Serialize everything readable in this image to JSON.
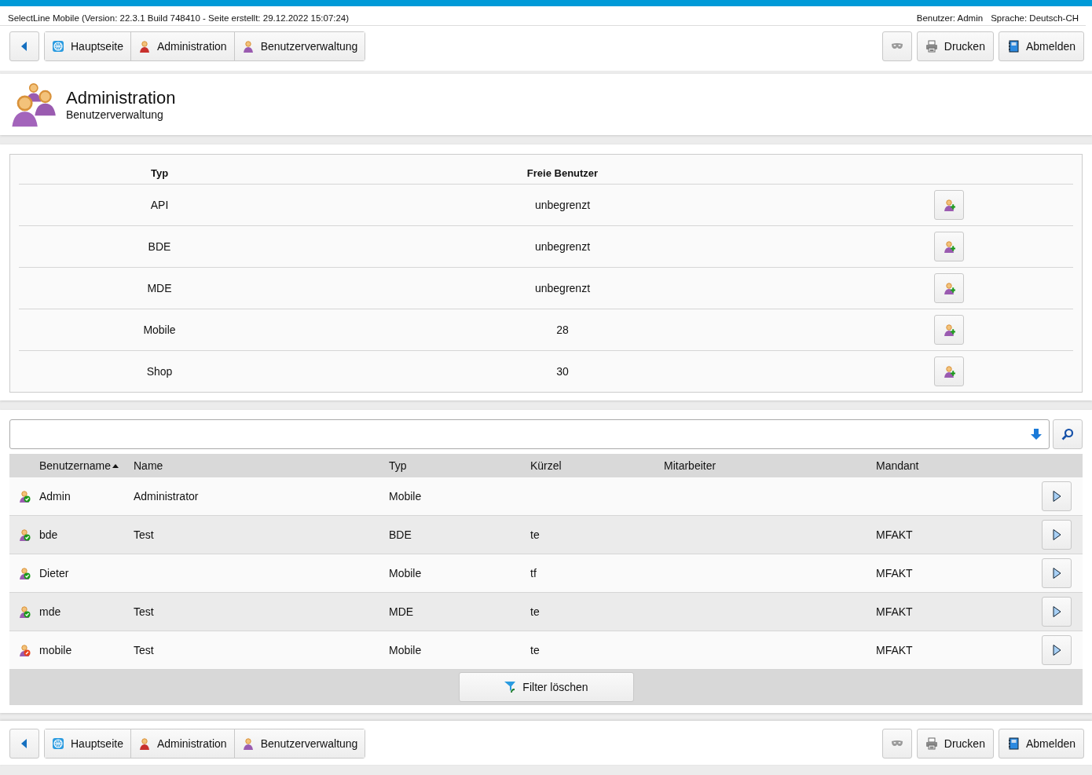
{
  "header": {
    "info": "SelectLine Mobile (Version: 22.3.1 Build 748410 - Seite erstellt: 29.12.2022 15:07:24)",
    "user": "Benutzer: Admin",
    "language": "Sprache: Deutsch-CH"
  },
  "nav_top": {
    "breadcrumbs": [
      {
        "kind": "globe",
        "label": "Hauptseite"
      },
      {
        "kind": "admin",
        "label": "Administration"
      },
      {
        "kind": "user",
        "label": "Benutzerverwaltung"
      }
    ],
    "actions": [
      {
        "kind": "mask"
      },
      {
        "kind": "print",
        "label": "Drucken"
      },
      {
        "kind": "logout",
        "label": "Abmelden"
      }
    ]
  },
  "page_header": {
    "title": "Administration",
    "subtitle": "Benutzerverwaltung"
  },
  "license_table": {
    "columns": [
      "Typ",
      "Freie Benutzer"
    ],
    "rows": [
      {
        "type": "API",
        "free": "unbegrenzt"
      },
      {
        "type": "BDE",
        "free": "unbegrenzt"
      },
      {
        "type": "MDE",
        "free": "unbegrenzt"
      },
      {
        "type": "Mobile",
        "free": "28"
      },
      {
        "type": "Shop",
        "free": "30"
      }
    ]
  },
  "users_table": {
    "columns": [
      {
        "label": "Benutzername",
        "sorted": true
      },
      {
        "label": "Name",
        "sorted": false
      },
      {
        "label": "Typ",
        "sorted": false
      },
      {
        "label": "Kürzel",
        "sorted": false
      },
      {
        "label": "Mitarbeiter",
        "sorted": false
      },
      {
        "label": "Mandant",
        "sorted": false
      }
    ],
    "rows": [
      {
        "username": "Admin",
        "name": "Administrator",
        "type": "Mobile",
        "short": "",
        "employee": "",
        "client": "",
        "active": true
      },
      {
        "username": "bde",
        "name": "Test",
        "type": "BDE",
        "short": "te",
        "employee": "",
        "client": "MFAKT",
        "active": true
      },
      {
        "username": "Dieter",
        "name": "",
        "type": "Mobile",
        "short": "tf",
        "employee": "",
        "client": "MFAKT",
        "active": true
      },
      {
        "username": "mde",
        "name": "Test",
        "type": "MDE",
        "short": "te",
        "employee": "",
        "client": "MFAKT",
        "active": true
      },
      {
        "username": "mobile",
        "name": "Test",
        "type": "Mobile",
        "short": "te",
        "employee": "",
        "client": "MFAKT",
        "active": false
      }
    ]
  },
  "filter_button": {
    "label": "Filter löschen"
  },
  "nav_bottom": {
    "breadcrumbs": [
      {
        "kind": "globe",
        "label": "Hauptseite"
      },
      {
        "kind": "admin",
        "label": "Administration"
      },
      {
        "kind": "user",
        "label": "Benutzerverwaltung"
      }
    ],
    "actions": [
      {
        "kind": "mask"
      },
      {
        "kind": "print",
        "label": "Drucken"
      },
      {
        "kind": "logout",
        "label": "Abmelden"
      }
    ]
  }
}
